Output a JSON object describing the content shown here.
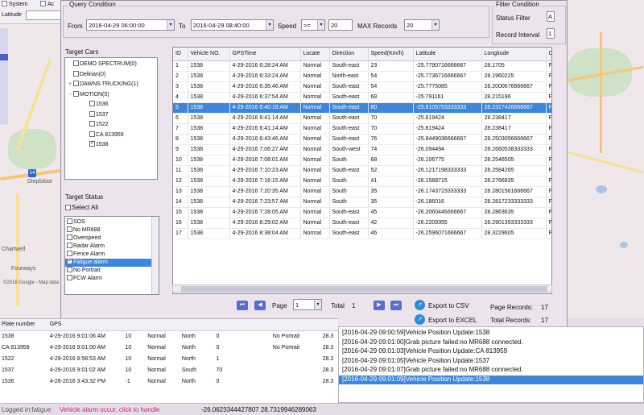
{
  "app_bar": {
    "system_label": "System",
    "ac_label": "Ac",
    "latitude_label": "Latitude"
  },
  "map": {
    "labels": [
      "Dieplsloot",
      "Chartwell",
      "Fourways",
      "©2016 Google - Map data"
    ],
    "route_badge": "14"
  },
  "query": {
    "group_title": "Query Condition",
    "from_label": "From",
    "from_value": "2016-04-29 06:00:00",
    "to_label": "To",
    "to_value": "2016-04-29 08:40:00",
    "speed_label": "Speed",
    "speed_op": ">=",
    "speed_value": "20",
    "max_records_label": "MAX Records",
    "max_records_value": "20"
  },
  "filter": {
    "group_title": "Filter Condition",
    "status_filter_label": "Status Filter",
    "status_filter_value": "A",
    "record_interval_label": "Record Interval",
    "record_interval_value": "1"
  },
  "target_cars": {
    "title": "Target Cars",
    "nodes": [
      {
        "label": "DEMO SPECTRUM(0)",
        "level": 0,
        "expander": "",
        "checked": false
      },
      {
        "label": "Delirian(0)",
        "level": 0,
        "expander": "",
        "checked": false
      },
      {
        "label": "DAWNS TRUCKING(1)",
        "level": 0,
        "expander": "+",
        "checked": false
      },
      {
        "label": "MOTION(5)",
        "level": 0,
        "expander": "−",
        "checked": false
      },
      {
        "label": "1536",
        "level": 1,
        "expander": "",
        "checked": false
      },
      {
        "label": "1537",
        "level": 1,
        "expander": "",
        "checked": false
      },
      {
        "label": "1522",
        "level": 1,
        "expander": "",
        "checked": false
      },
      {
        "label": "CA 813959",
        "level": 1,
        "expander": "",
        "checked": false
      },
      {
        "label": "1538",
        "level": 1,
        "expander": "",
        "checked": true
      }
    ]
  },
  "target_status": {
    "title": "Target Status",
    "select_all_label": "Select All",
    "items": [
      "SOS",
      "No MR688",
      "Overspeed",
      "Radar Alarm",
      "Fence Alarm",
      "Fatigue alarm",
      "No Portrait",
      "FCW Alarm"
    ],
    "selected_index": 5
  },
  "grid": {
    "columns": [
      "ID",
      "Vehicle NO.",
      "GPSTime",
      "Locate",
      "Direction",
      "Speed(Km/h)",
      "Latitude",
      "Longitude",
      "Co"
    ],
    "selected_row": 4,
    "rows": [
      [
        "1",
        "1538",
        "4-29-2016 6:28:24 AM",
        "Normal",
        "South-east",
        "23",
        "-25.7790716666667",
        "28.1705",
        "Fa"
      ],
      [
        "2",
        "1538",
        "4-29-2016 6:33:24 AM",
        "Normal",
        "North-east",
        "54",
        "-25.7736716666667",
        "28.1960225",
        "Fa"
      ],
      [
        "3",
        "1538",
        "4-29-2016 6:35:46 AM",
        "Normal",
        "South-east",
        "54",
        "-25.7775085",
        "28.2000676666667",
        "Fa"
      ],
      [
        "4",
        "1538",
        "4-29-2016 6:37:54 AM",
        "Normal",
        "South-east",
        "68",
        "-25.791161",
        "28.215196",
        "Fa"
      ],
      [
        "5",
        "1538",
        "4-29-2016 6:40:18 AM",
        "Normal",
        "South-east",
        "80",
        "-25.8105753333333",
        "28.2317426666667",
        "Fa"
      ],
      [
        "6",
        "1538",
        "4-29-2016 6:41:14 AM",
        "Normal",
        "South-east",
        "70",
        "-25.819424",
        "28.238417",
        "Fa"
      ],
      [
        "7",
        "1538",
        "4-29-2016 6:41:14 AM",
        "Normal",
        "South-east",
        "70",
        "-25.819424",
        "28.238417",
        "Fa"
      ],
      [
        "8",
        "1538",
        "4-29-2016 6:43:46 AM",
        "Normal",
        "South-east",
        "76",
        "-25.8449036666667",
        "28.2503056666667",
        "Fa"
      ],
      [
        "9",
        "1538",
        "4-29-2016 7:06:27 AM",
        "Normal",
        "South-west",
        "74",
        "-26.094494",
        "28.2660538333333",
        "Fa"
      ],
      [
        "10",
        "1538",
        "4-29-2016 7:08:01 AM",
        "Normal",
        "South",
        "68",
        "-26.106775",
        "28.2546505",
        "Fa"
      ],
      [
        "11",
        "1538",
        "4-29-2016 7:10:23 AM",
        "Normal",
        "South-east",
        "52",
        "-26.1217198333333",
        "28.2584265",
        "Fa"
      ],
      [
        "12",
        "1538",
        "4-29-2016 7:16:15 AM",
        "Normal",
        "South",
        "41",
        "-26.1588715",
        "28.2766935",
        "Fa"
      ],
      [
        "13",
        "1538",
        "4-29-2016 7:20:35 AM",
        "Normal",
        "South",
        "35",
        "-26.1743723333333",
        "28.2801561666667",
        "Fa"
      ],
      [
        "14",
        "1538",
        "4-29-2016 7:23:57 AM",
        "Normal",
        "South",
        "35",
        "-26.186016",
        "28.2817233333333",
        "Fa"
      ],
      [
        "15",
        "1538",
        "4-29-2016 7:28:05 AM",
        "Normal",
        "South-east",
        "45",
        "-26.2060446666667",
        "28.2863635",
        "Fa"
      ],
      [
        "16",
        "1538",
        "4-29-2016 8:29:02 AM",
        "Normal",
        "South-east",
        "42",
        "-26.2209355",
        "28.2901393333333",
        "Fa"
      ],
      [
        "17",
        "1538",
        "4-29-2016 8:38:04 AM",
        "Normal",
        "South-east",
        "46",
        "-26.2596071666667",
        "28.3229605",
        "Fa"
      ]
    ]
  },
  "pager": {
    "page_label": "Page",
    "page_value": "1",
    "total_label": "Total",
    "total_value": "1",
    "export_csv_label": "Export to CSV",
    "export_excel_label": "Export to EXCEL",
    "page_records_label": "Page Records:",
    "page_records_value": "17",
    "total_records_label": "Total Records:",
    "total_records_value": "17"
  },
  "bottom_table": {
    "columns": [
      "Plate number",
      "GPS",
      "",
      "",
      "",
      "",
      "",
      "",
      ""
    ],
    "rows": [
      [
        "1538",
        "4-29-2016 9:01:06 AM",
        "10",
        "Normal",
        "North",
        "0",
        "",
        "No Portrait",
        "28.3"
      ],
      [
        "CA 813959",
        "4-29-2016 9:01:00 AM",
        "10",
        "Normal",
        "North",
        "0",
        "",
        "No Portrait",
        "28.3"
      ],
      [
        "1522",
        "4-29-2016 8:58:53 AM",
        "10",
        "Normal",
        "North",
        "1",
        "",
        "",
        "28.3"
      ],
      [
        "1537",
        "4-29-2016 9:01:02 AM",
        "10",
        "Normal",
        "South",
        "70",
        "",
        "",
        "28.3"
      ],
      [
        "1536",
        "4-28-2016 3:43:32 PM",
        "-1",
        "Normal",
        "North",
        "0",
        "",
        "",
        "28.3"
      ]
    ]
  },
  "log": {
    "lines": [
      "[2016-04-29 09:00:59]Vehicle Position Update:1538",
      "[2016-04-29 09:01:00]Grab picture failed:no MR688 connected.",
      "[2016-04-29 09:01:03]Vehicle Position Update:CA 813959",
      "[2016-04-29 09:01:05]Vehicle Position Update:1537",
      "[2016-04-29 09:01:07]Grab picture failed:no MR688 connected.",
      "[2016-04-29 09:01:09]Vehicle Position Update:1538"
    ],
    "selected_index": 5
  },
  "status_bar": {
    "logged_label": "Logged in:fatigue",
    "alarm_text": "Vehicle alarm occur, click to handle",
    "coords": "-26.0623344427807 28.7319946289063"
  },
  "colors": {
    "selection": "#3f86d8",
    "alarm": "#d8236a",
    "pager_button": "#5b6dc8"
  }
}
